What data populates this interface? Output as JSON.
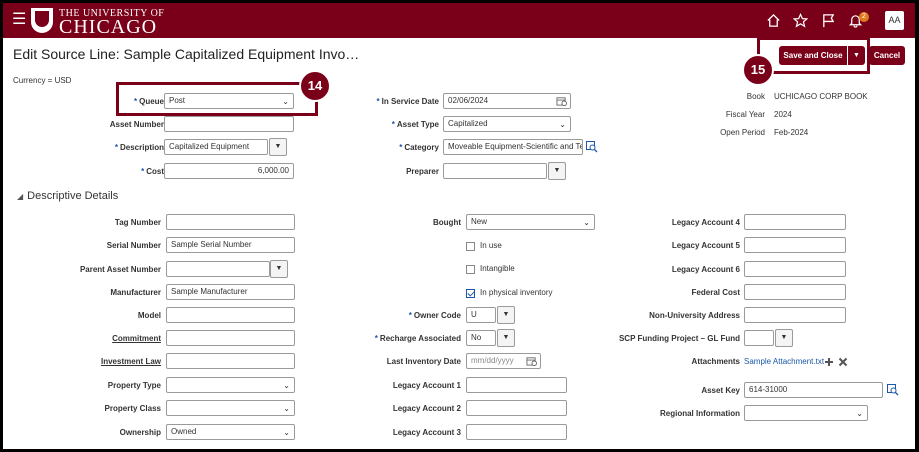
{
  "header": {
    "menu_icon": "hamburger-icon",
    "brand_line1": "THE UNIVERSITY OF",
    "brand_line2": "CHICAGO",
    "notification_count": "2",
    "avatar": "AA"
  },
  "page": {
    "title": "Edit Source Line: Sample Capitalized Equipment Invo…",
    "currency": "Currency = USD",
    "save_close": "Save and Close",
    "cancel": "Cancel"
  },
  "callouts": {
    "c14": "14",
    "c15": "15"
  },
  "general": {
    "queue": {
      "label": "Queue",
      "value": "Post"
    },
    "asset_number": {
      "label": "Asset Number",
      "value": ""
    },
    "description": {
      "label": "Description",
      "value": "Capitalized Equipment"
    },
    "cost": {
      "label": "Cost",
      "value": "6,000.00"
    },
    "in_service_date": {
      "label": "In Service Date",
      "value": "02/06/2024"
    },
    "asset_type": {
      "label": "Asset Type",
      "value": "Capitalized"
    },
    "category": {
      "label": "Category",
      "value": "Moveable Equipment-Scientific and Te"
    },
    "preparer": {
      "label": "Preparer",
      "value": ""
    },
    "book": {
      "label": "Book",
      "value": "UCHICAGO CORP BOOK"
    },
    "fiscal_year": {
      "label": "Fiscal Year",
      "value": "2024"
    },
    "open_period": {
      "label": "Open Period",
      "value": "Feb-2024"
    }
  },
  "descriptive": {
    "section_title": "Descriptive Details",
    "tag_number": {
      "label": "Tag Number",
      "value": ""
    },
    "serial_number": {
      "label": "Serial Number",
      "value": "Sample Serial Number"
    },
    "parent_asset_number": {
      "label": "Parent Asset Number",
      "value": ""
    },
    "manufacturer": {
      "label": "Manufacturer",
      "value": "Sample Manufacturer"
    },
    "model": {
      "label": "Model",
      "value": ""
    },
    "commitment": {
      "label": "Commitment",
      "value": ""
    },
    "investment_law": {
      "label": "Investment Law",
      "value": ""
    },
    "property_type": {
      "label": "Property Type",
      "value": ""
    },
    "property_class": {
      "label": "Property Class",
      "value": ""
    },
    "ownership": {
      "label": "Ownership",
      "value": "Owned"
    },
    "bought": {
      "label": "Bought",
      "value": "New"
    },
    "in_use": {
      "label": "In use",
      "checked": false
    },
    "intangible": {
      "label": "Intangible",
      "checked": false
    },
    "in_physical_inventory": {
      "label": "In physical inventory",
      "checked": true
    },
    "owner_code": {
      "label": "Owner Code",
      "value": "U"
    },
    "recharge_associated": {
      "label": "Recharge Associated",
      "value": "No"
    },
    "last_inventory_date": {
      "label": "Last Inventory Date",
      "placeholder": "mm/dd/yyyy"
    },
    "legacy_account_1": {
      "label": "Legacy Account 1",
      "value": ""
    },
    "legacy_account_2": {
      "label": "Legacy Account 2",
      "value": ""
    },
    "legacy_account_3": {
      "label": "Legacy Account 3",
      "value": ""
    },
    "legacy_account_4": {
      "label": "Legacy Account 4",
      "value": ""
    },
    "legacy_account_5": {
      "label": "Legacy Account 5",
      "value": ""
    },
    "legacy_account_6": {
      "label": "Legacy Account 6",
      "value": ""
    },
    "federal_cost": {
      "label": "Federal Cost",
      "value": ""
    },
    "non_university_address": {
      "label": "Non-University Address",
      "value": ""
    },
    "scp_funding_project": {
      "label": "SCP Funding Project – GL Fund",
      "value": ""
    },
    "attachments": {
      "label": "Attachments",
      "value": "Sample Attachment.txt"
    },
    "asset_key": {
      "label": "Asset Key",
      "value": "614-31000"
    },
    "regional_information": {
      "label": "Regional Information",
      "value": ""
    }
  },
  "colors": {
    "brand": "#7a0019",
    "link": "#1a57a8"
  }
}
